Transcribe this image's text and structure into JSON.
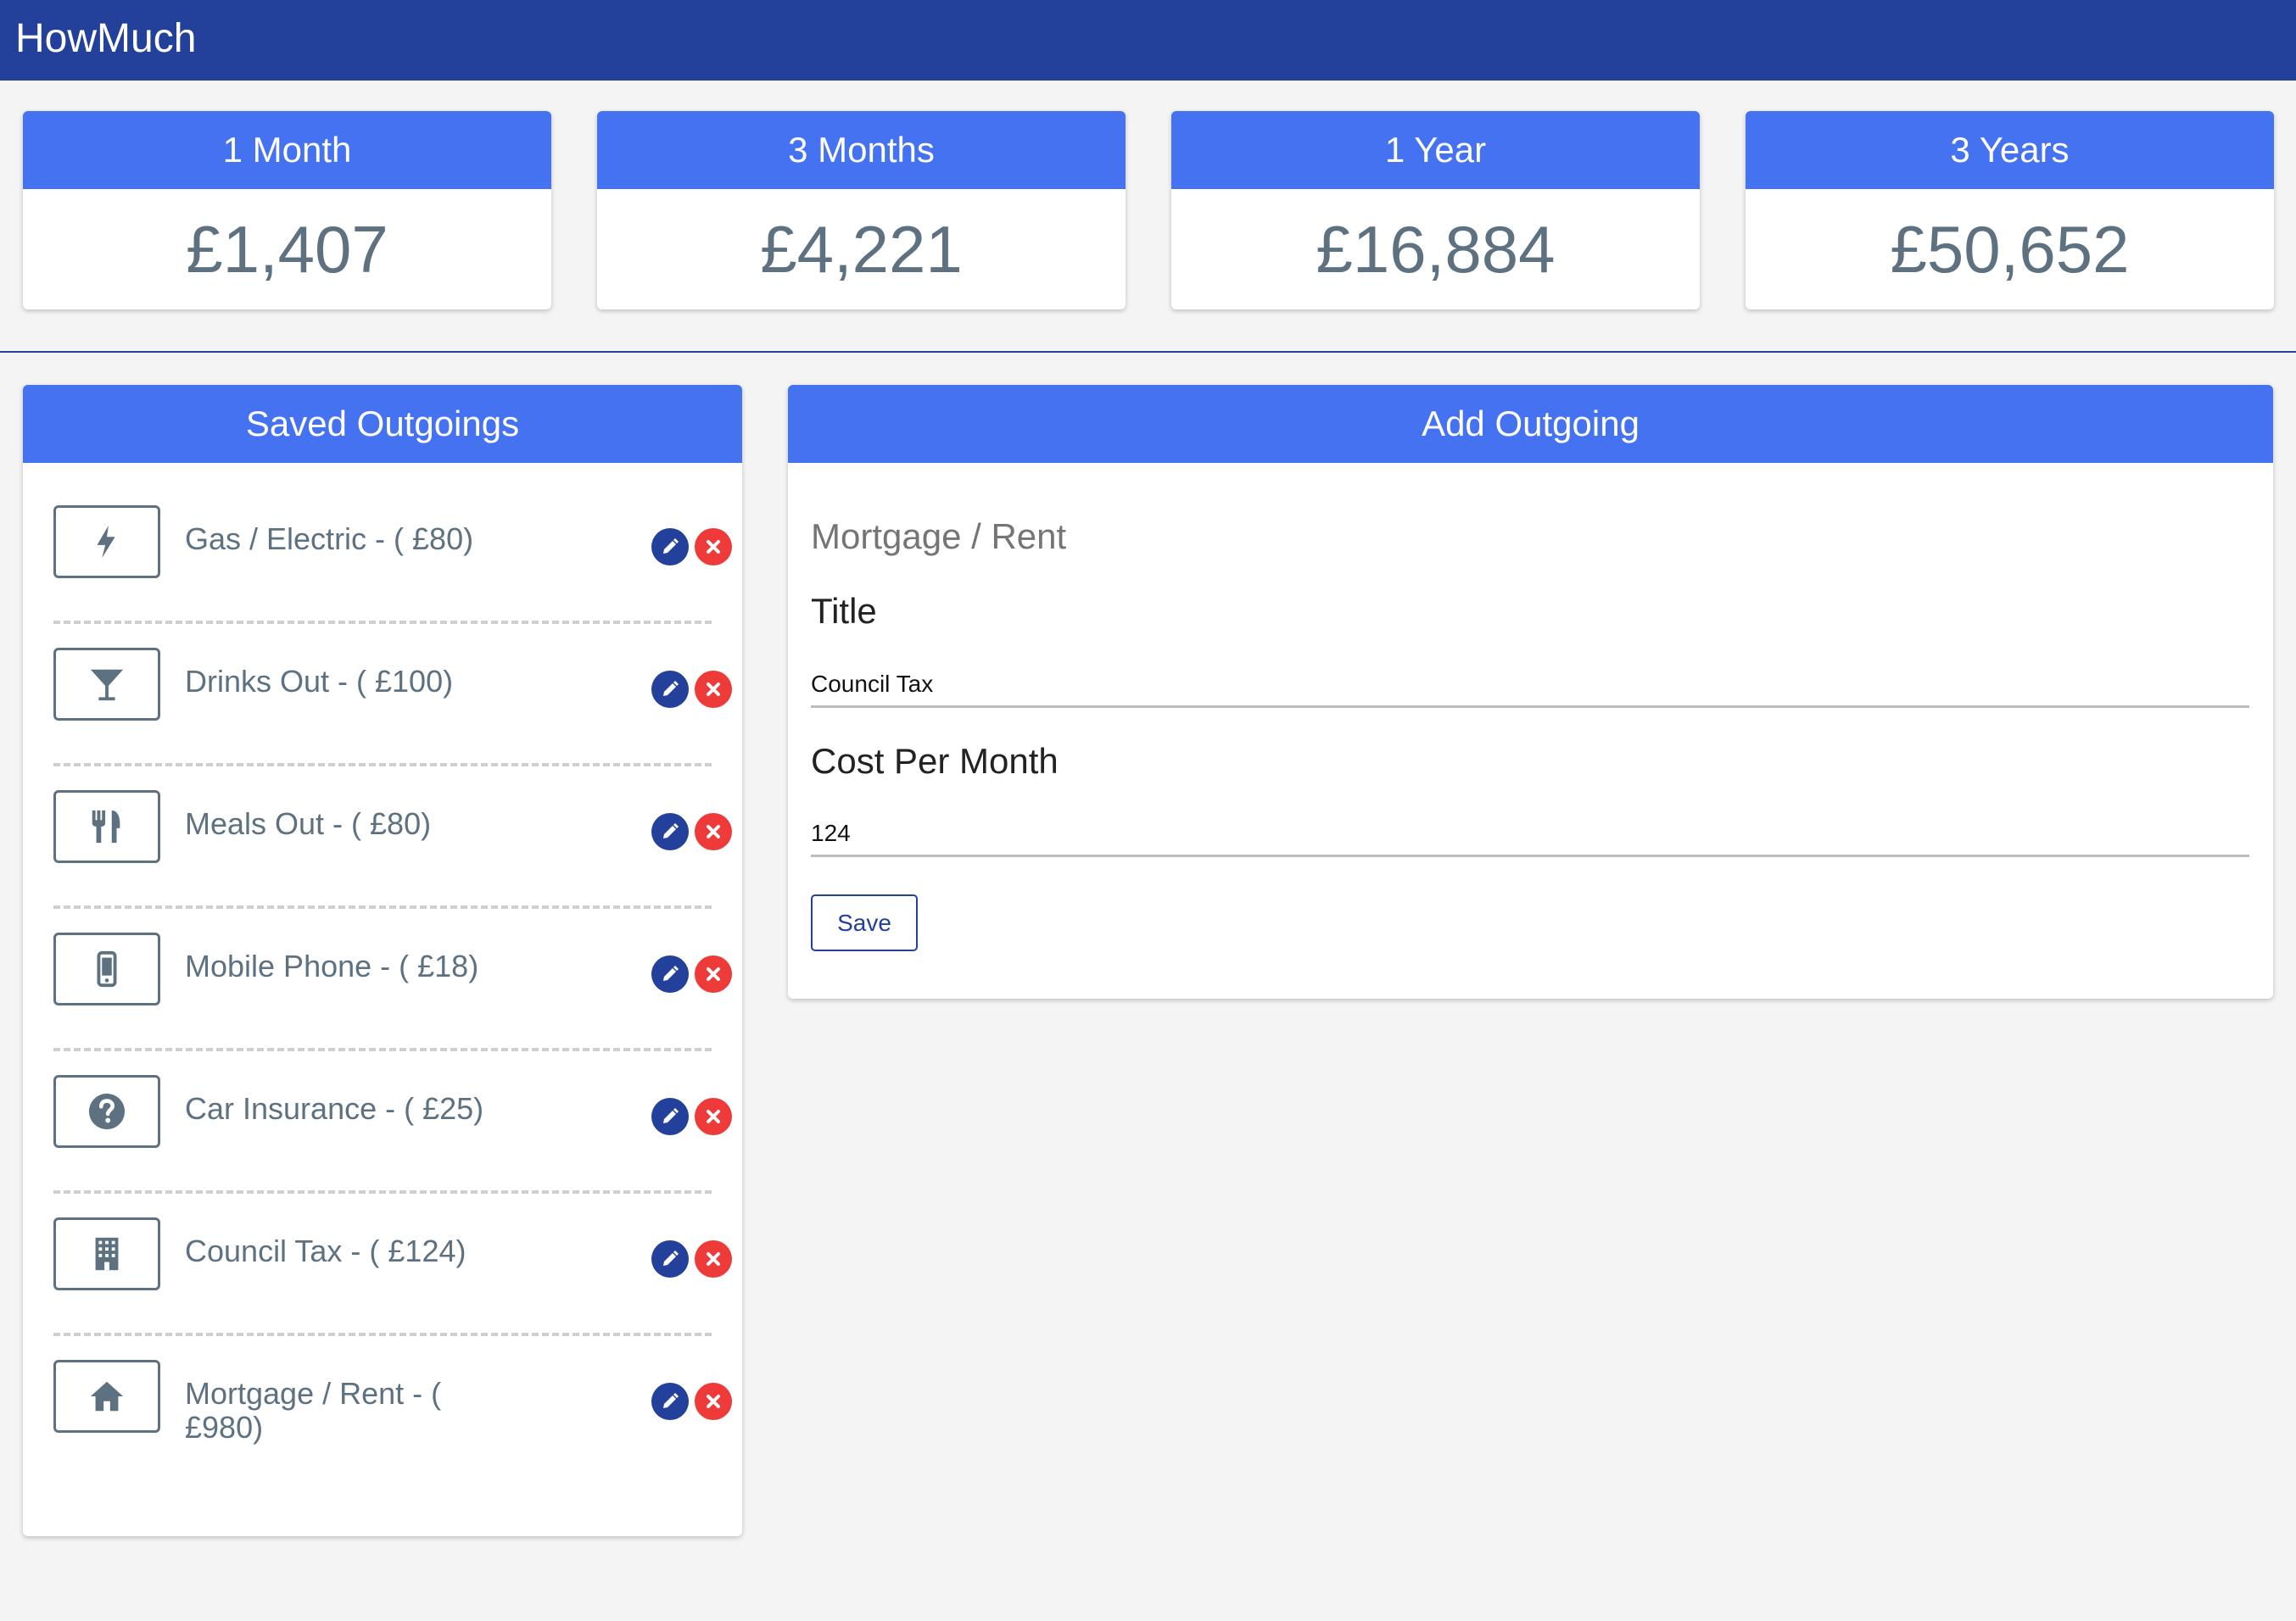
{
  "app": {
    "title": "HowMuch"
  },
  "stats": [
    {
      "period": "1 Month",
      "amount": "£1,407"
    },
    {
      "period": "3 Months",
      "amount": "£4,221"
    },
    {
      "period": "1 Year",
      "amount": "£16,884"
    },
    {
      "period": "3 Years",
      "amount": "£50,652"
    }
  ],
  "saved": {
    "title": "Saved Outgoings",
    "items": [
      {
        "label": "Gas / Electric - ( £80)",
        "icon": "lightning-icon"
      },
      {
        "label": "Drinks Out - ( £100)",
        "icon": "cocktail-icon"
      },
      {
        "label": "Meals Out - ( £80)",
        "icon": "cutlery-icon"
      },
      {
        "label": "Mobile Phone - ( £18)",
        "icon": "mobile-phone-icon"
      },
      {
        "label": "Car Insurance - ( £25)",
        "icon": "question-circle-icon"
      },
      {
        "label": "Council Tax - ( £124)",
        "icon": "building-icon"
      },
      {
        "label": "Mortgage / Rent - ( £980)",
        "icon": "home-icon"
      }
    ]
  },
  "add": {
    "title": "Add Outgoing",
    "category": "Mortgage / Rent",
    "title_label": "Title",
    "title_value": "Council Tax",
    "cost_label": "Cost Per Month",
    "cost_value": "124",
    "save_label": "Save"
  },
  "colors": {
    "navbar": "#23409b",
    "card_header": "#4472f0",
    "value_text": "#5d7181",
    "edit": "#23409b",
    "delete": "#ef3a3a"
  }
}
